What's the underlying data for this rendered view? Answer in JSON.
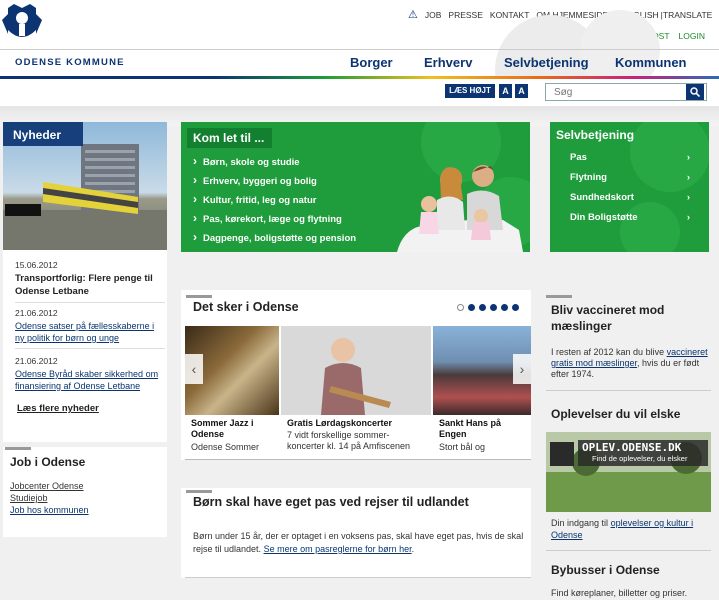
{
  "header": {
    "brand": "ODENSE KOMMUNE",
    "toplinks": [
      "JOB",
      "PRESSE",
      "KONTAKT",
      "OM HJEMMESIDEN",
      "ENGLISH",
      "|TRANSLATE"
    ],
    "loglinks": [
      "DIGITALPOST",
      "LOGIN"
    ],
    "mainnav": [
      "Borger",
      "Erhverv",
      "Selvbetjening",
      "Kommunen"
    ]
  },
  "tools": {
    "laes": "LÆS HØJT",
    "a_small": "A",
    "a_large": "A"
  },
  "search": {
    "placeholder": "Søg"
  },
  "news": {
    "title": "Nyheder",
    "items": [
      {
        "date": "15.06.2012",
        "text": "Transportforlig: Flere penge til Odense Letbane"
      },
      {
        "date": "21.06.2012",
        "text": "Odense satser på fællesskaberne i ny politik for børn og unge"
      },
      {
        "date": "21.06.2012",
        "text": "Odense Byråd skaber sikkerhed om finansiering af Odense Letbane"
      }
    ],
    "more": "Læs flere nyheder"
  },
  "kom": {
    "title": "Kom let til ...",
    "items": [
      "Børn, skole og studie",
      "Erhverv, byggeri og bolig",
      "Kultur, fritid, leg og natur",
      "Pas, kørekort, læge og flytning",
      "Dagpenge, boligstøtte og pension"
    ]
  },
  "selv": {
    "title": "Selvbetjening",
    "items": [
      "Pas",
      "Flytning",
      "Sundhedskort",
      "Din Boligstøtte"
    ]
  },
  "sker": {
    "title": "Det sker i Odense",
    "cards": [
      {
        "title": "Sommer Jazz i Odense",
        "desc": "Odense Sommer"
      },
      {
        "title": "Gratis Lørdagskoncerter",
        "desc": "7 vidt forskellige sommer-koncerter kl. 14 på Amfiscenen"
      },
      {
        "title": "Sankt Hans på Engen",
        "desc": "Stort bål og"
      }
    ]
  },
  "pas": {
    "title": "Børn skal have eget pas ved rejser til udlandet",
    "text": "Børn under 15 år, der er optaget i en voksens pas, skal have eget pas, hvis de skal rejse til udlandet.",
    "link": "Se mere om pasreglerne for børn her"
  },
  "job": {
    "title": "Job i Odense",
    "links": [
      "Jobcenter Odense",
      "Studiejob",
      "Job hos kommunen"
    ]
  },
  "right": {
    "vacc_title": "Bliv vaccineret mod mæslinger",
    "vacc_text1": "I resten af 2012 kan du blive",
    "vacc_link": "vaccineret gratis mod mæslinger",
    "vacc_text2": ", hvis du er født efter 1974.",
    "opl_title": "Oplevelser du vil elske",
    "opl_banner": "OPLEV.ODENSE.DK",
    "opl_banner_sub": "Find de oplevelser, du elsker",
    "opl_text1": "Din indgang til",
    "opl_link": "oplevelser og kultur i Odense",
    "bus_title": "Bybusser i Odense",
    "bus_text": "Find køreplaner, billetter og priser."
  }
}
